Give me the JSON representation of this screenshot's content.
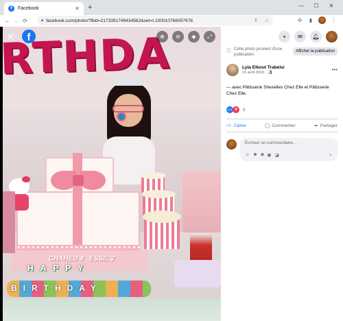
{
  "browser": {
    "tab_title": "Facebook",
    "tab_close": "✕",
    "new_tab": "+",
    "url": "facebook.com/photo/?fbid=2173391749434582&set=t.100010768057678",
    "controls": {
      "minimize": "—",
      "maximize": "☐",
      "close": "✕"
    },
    "nav": {
      "back": "←",
      "forward": "→",
      "reload": "⟳"
    }
  },
  "photo": {
    "balloons": "RTHDA",
    "cake_names": "CHAHED 4   ESSIL 2",
    "happy_text": "HAPPY",
    "birthday_text": "BIRTHDAY",
    "icons": [
      "close-icon",
      "facebook-logo-icon",
      "zoom-in-icon",
      "zoom-out-icon",
      "tag-icon",
      "fullscreen-icon"
    ]
  },
  "panel": {
    "notice_text": "Cette photo provient d'une publication.",
    "notice_button": "Afficher la publication",
    "author": "Lyla Elkout Trabelsi",
    "date": "15 avril 2019 · ",
    "post_text": "— avec Pâtisserie Sheselles Chez Elle et Pâtisserie Chez Elle.",
    "reaction_count": "5",
    "like_label": "J'aime",
    "comment_label": "Commenter",
    "share_label": "Partager",
    "comment_placeholder": "Écrivez un commentaire…",
    "colors": {
      "accent": "#1877f2",
      "love": "#f33e58"
    }
  }
}
